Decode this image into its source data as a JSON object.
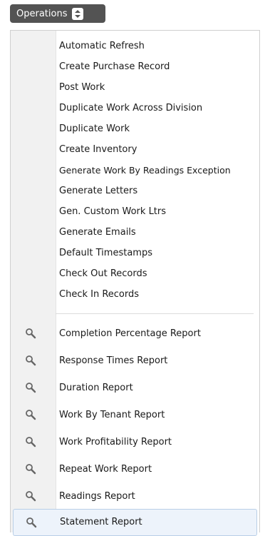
{
  "operations_button": {
    "label": "Operations"
  },
  "menu": {
    "actions": [
      "Automatic Refresh",
      "Create Purchase Record",
      "Post Work",
      "Duplicate Work Across Division",
      "Duplicate Work",
      "Create Inventory",
      "Generate Work By Readings Exception",
      "Generate Letters",
      "Gen. Custom Work Ltrs",
      "Generate Emails",
      "Default Timestamps",
      "Check Out Records",
      "Check In Records"
    ],
    "reports": [
      {
        "label": "Completion Percentage Report",
        "icon": "search-icon"
      },
      {
        "label": "Response Times Report",
        "icon": "search-icon"
      },
      {
        "label": "Duration Report",
        "icon": "search-icon"
      },
      {
        "label": "Work By Tenant Report",
        "icon": "search-icon"
      },
      {
        "label": "Work Profitability Report",
        "icon": "search-icon"
      },
      {
        "label": "Repeat Work Report",
        "icon": "search-icon"
      },
      {
        "label": "Readings Report",
        "icon": "search-icon"
      },
      {
        "label": "Statement Report",
        "icon": "search-icon",
        "selected": true
      }
    ]
  },
  "colors": {
    "button_bg": "#535353",
    "gutter_bg": "#f1f1f1",
    "selected_bg": "#edf3fb",
    "selected_border": "#b9cfe7",
    "icon_color": "#666666"
  }
}
